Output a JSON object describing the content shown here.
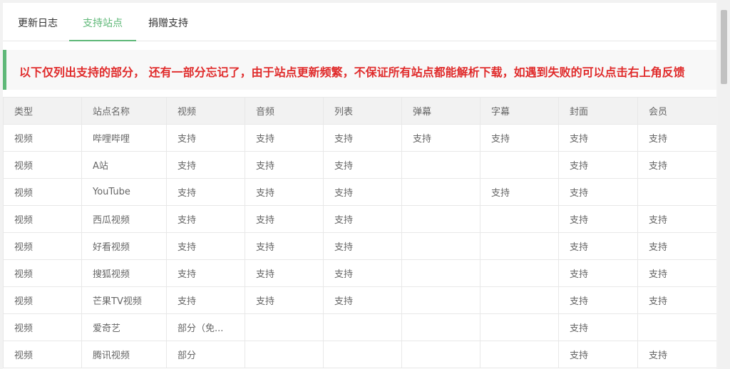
{
  "tabs": [
    {
      "label": "更新日志",
      "active": false
    },
    {
      "label": "支持站点",
      "active": true
    },
    {
      "label": "捐赠支持",
      "active": false
    }
  ],
  "notice": "以下仅列出支持的部分， 还有一部分忘记了，由于站点更新频繁，不保证所有站点都能解析下载，如遇到失败的可以点击右上角反馈",
  "colors": {
    "accent": "#5fb878",
    "notice_text": "#e02b2b"
  },
  "table": {
    "headers": [
      "类型",
      "站点名称",
      "视频",
      "音频",
      "列表",
      "弹幕",
      "字幕",
      "封面",
      "会员"
    ],
    "rows": [
      [
        "视频",
        "哔哩哔哩",
        "支持",
        "支持",
        "支持",
        "支持",
        "支持",
        "支持",
        "支持"
      ],
      [
        "视频",
        "A站",
        "支持",
        "支持",
        "支持",
        "",
        "",
        "支持",
        "支持"
      ],
      [
        "视频",
        "YouTube",
        "支持",
        "支持",
        "支持",
        "",
        "支持",
        "支持",
        ""
      ],
      [
        "视频",
        "西瓜视频",
        "支持",
        "支持",
        "支持",
        "",
        "",
        "支持",
        "支持"
      ],
      [
        "视频",
        "好看视频",
        "支持",
        "支持",
        "支持",
        "",
        "",
        "支持",
        "支持"
      ],
      [
        "视频",
        "搜狐视频",
        "支持",
        "支持",
        "支持",
        "",
        "",
        "支持",
        "支持"
      ],
      [
        "视频",
        "芒果TV视频",
        "支持",
        "支持",
        "支持",
        "",
        "",
        "支持",
        "支持"
      ],
      [
        "视频",
        "爱奇艺",
        "部分（免...",
        "",
        "",
        "",
        "",
        "支持",
        ""
      ],
      [
        "视频",
        "腾讯视频",
        "部分",
        "",
        "",
        "",
        "",
        "支持",
        "支持"
      ]
    ]
  }
}
